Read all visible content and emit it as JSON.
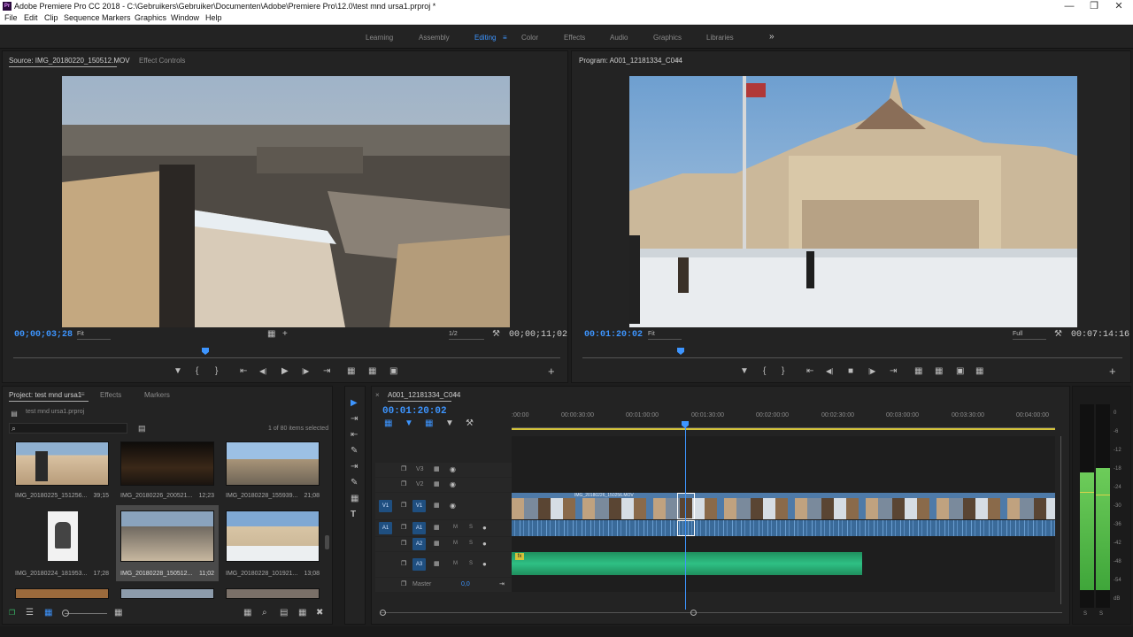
{
  "window": {
    "title": "Adobe Premiere Pro CC 2018 - C:\\Gebruikers\\Gebruiker\\Documenten\\Adobe\\Premiere Pro\\12.0\\test mnd ursa1.prproj *",
    "app_icon": "Pr",
    "min": "—",
    "restore": "❒",
    "close": "✕"
  },
  "menu": [
    "File",
    "Edit",
    "Clip",
    "Sequence",
    "Markers",
    "Graphics",
    "Window",
    "Help"
  ],
  "workspaces": {
    "items": [
      "Learning",
      "Assembly",
      "Editing",
      "Color",
      "Effects",
      "Audio",
      "Graphics",
      "Libraries"
    ],
    "active": "Editing",
    "more": "»",
    "menu_glyph": "≡"
  },
  "source": {
    "tab": "Source: IMG_20180220_150512.MOV",
    "tab2": "Effect Controls",
    "timecode": "00;00;03;28",
    "fit": "Fit",
    "resolution": "1/2",
    "duration": "00;00;11;02",
    "menu_glyph": "≡"
  },
  "program": {
    "tab": "Program: A001_12181334_C044",
    "timecode": "00:01:20:02",
    "fit": "Fit",
    "resolution": "Full",
    "duration": "00:07:14:16",
    "menu_glyph": "≡"
  },
  "project": {
    "tabs": [
      "Project: test mnd ursa1",
      "Effects",
      "Markers"
    ],
    "menu_glyph": "≡",
    "file": "test mnd ursa1.prproj",
    "items_selected": "1 of 80 items selected",
    "search_icon": "⌕",
    "items": [
      {
        "name": "IMG_20180225_151256...",
        "dur": "39;15"
      },
      {
        "name": "IMG_20180226_200521...",
        "dur": "12;23"
      },
      {
        "name": "IMG_20180228_155939...",
        "dur": "21;08"
      },
      {
        "name": "IMG_20180224_181953...",
        "dur": "17;28"
      },
      {
        "name": "IMG_20180228_150512...",
        "dur": "11;02"
      },
      {
        "name": "IMG_20180228_101921...",
        "dur": "13;08"
      }
    ]
  },
  "timeline": {
    "tab": "A001_12181334_C044",
    "menu_glyph": "≡",
    "close": "×",
    "timecode": "00:01:20:02",
    "ruler": [
      ":00:00",
      "00:00:30:00",
      "00:01:00:00",
      "00:01:30:00",
      "00:02:00:00",
      "00:02:30:00",
      "00:03:00:00",
      "00:03:30:00",
      "00:04:00:00"
    ],
    "video_tracks": [
      "V3",
      "V2",
      "V1"
    ],
    "audio_tracks": [
      "A1",
      "A2",
      "A3"
    ],
    "source_v": "V1",
    "source_a": "A1",
    "master": "Master",
    "master_val": "0,0",
    "clip_label": "IMG_20180226_150256.MOV",
    "badge": "fx",
    "m": "M",
    "s": "S"
  },
  "meter": {
    "labels": [
      "0",
      "-6",
      "-12",
      "-18",
      "-24",
      "-30",
      "-36",
      "-42",
      "-48",
      "-54",
      "dB"
    ],
    "solo": "S"
  },
  "icons": {
    "play": "▶",
    "step_back": "◀|",
    "step_fwd": "|▶",
    "goto_in": "⇤",
    "goto_out": "⇥",
    "marker": "▼",
    "in": "{",
    "out": "}",
    "plus": "+",
    "camera": "▣",
    "wrench": "⚒",
    "lock": "❐",
    "eye": "◉",
    "mic": "●",
    "folder": "▤",
    "pencil": "✎",
    "list": "☰",
    "grid": "▦",
    "trash": "✖",
    "stop": "■"
  }
}
